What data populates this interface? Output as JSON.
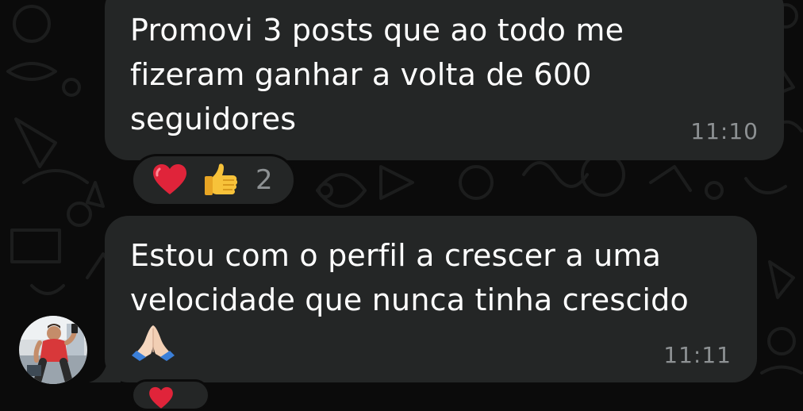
{
  "messages": [
    {
      "text": "Promovi 3 posts que ao todo me\nfizeram ganhar a volta de 600\nseguidores",
      "time": "11:10",
      "reactions": {
        "emojis": [
          "red-heart",
          "thumbs-up"
        ],
        "count": "2"
      }
    },
    {
      "text": "Estou com o perfil a crescer a uma\nvelocidade que nunca tinha crescido",
      "emoji": "folded-hands",
      "time": "11:11",
      "reactions": {
        "emojis": [
          "red-heart"
        ]
      }
    }
  ],
  "colors": {
    "background": "#0b0b0b",
    "bubble": "#242626",
    "text": "#ffffff",
    "meta": "#8d9193",
    "heart": "#e0243a",
    "thumb": "#f7c23a"
  }
}
